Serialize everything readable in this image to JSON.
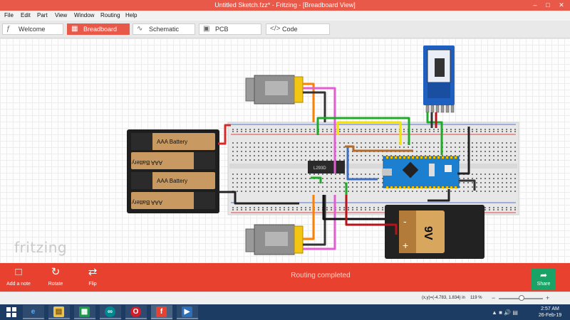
{
  "window": {
    "title": "Untitled Sketch.fzz* - Fritzing - [Breadboard View]"
  },
  "menu": [
    "File",
    "Edit",
    "Part",
    "View",
    "Window",
    "Routing",
    "Help"
  ],
  "tabs": [
    {
      "label": "Welcome",
      "icon": "fritzing-icon"
    },
    {
      "label": "Breadboard",
      "icon": "breadboard-icon",
      "active": true
    },
    {
      "label": "Schematic",
      "icon": "schematic-icon"
    },
    {
      "label": "PCB",
      "icon": "pcb-icon"
    },
    {
      "label": "Code",
      "icon": "code-icon"
    }
  ],
  "canvas": {
    "logo": "fritzing",
    "battery_pack": {
      "cells": [
        "AAA Battery",
        "AAA Battery",
        "AAA Battery",
        "AAA Battery"
      ]
    },
    "battery_9v": {
      "label": "9V",
      "minus": "-",
      "plus": "+"
    },
    "motor_driver_chip": "L293D",
    "bluetooth_module": "HC-05",
    "microcontroller": "Arduino Nano"
  },
  "toolbar": {
    "add_note": "Add a note",
    "rotate": "Rotate",
    "flip": "Flip",
    "share": "Share",
    "status": "Routing completed"
  },
  "statusbar": {
    "coords": "(x,y)=(-4.783, 1.834) in",
    "zoom": "119 %"
  },
  "taskbar": {
    "time": "2:57 AM",
    "date": "26-Feb-19",
    "apps": [
      "internet-explorer",
      "file-explorer",
      "store",
      "arduino",
      "opera",
      "fritzing",
      "media"
    ]
  },
  "colors": {
    "accent": "#e8412f",
    "title": "#e8594a",
    "share": "#1aa366",
    "taskbar": "#1d3c63"
  }
}
